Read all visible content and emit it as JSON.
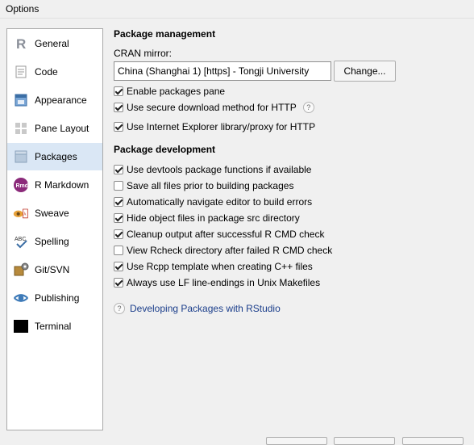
{
  "window": {
    "title": "Options"
  },
  "sidebar": {
    "items": [
      {
        "label": "General",
        "icon": "r-logo-icon",
        "active": false
      },
      {
        "label": "Code",
        "icon": "code-document-icon",
        "active": false
      },
      {
        "label": "Appearance",
        "icon": "appearance-icon",
        "active": false
      },
      {
        "label": "Pane Layout",
        "icon": "pane-layout-icon",
        "active": false
      },
      {
        "label": "Packages",
        "icon": "packages-icon",
        "active": true
      },
      {
        "label": "R Markdown",
        "icon": "rmd-icon",
        "active": false
      },
      {
        "label": "Sweave",
        "icon": "sweave-icon",
        "active": false
      },
      {
        "label": "Spelling",
        "icon": "spelling-icon",
        "active": false
      },
      {
        "label": "Git/SVN",
        "icon": "git-icon",
        "active": false
      },
      {
        "label": "Publishing",
        "icon": "publishing-icon",
        "active": false
      },
      {
        "label": "Terminal",
        "icon": "terminal-icon",
        "active": false
      }
    ]
  },
  "management": {
    "title": "Package management",
    "cran_label": "CRAN mirror:",
    "cran_value": "China (Shanghai 1) [https] - Tongji University",
    "change_button": "Change...",
    "options": [
      {
        "label": "Enable packages pane",
        "checked": true
      },
      {
        "label": "Use secure download method for HTTP",
        "checked": true,
        "help": "?"
      },
      {
        "label": "Use Internet Explorer library/proxy for HTTP",
        "checked": true
      }
    ]
  },
  "development": {
    "title": "Package development",
    "options": [
      {
        "label": "Use devtools package functions if available",
        "checked": true
      },
      {
        "label": "Save all files prior to building packages",
        "checked": false
      },
      {
        "label": "Automatically navigate editor to build errors",
        "checked": true
      },
      {
        "label": "Hide object files in package src directory",
        "checked": true
      },
      {
        "label": "Cleanup output after successful R CMD check",
        "checked": true
      },
      {
        "label": "View Rcheck directory after failed R CMD check",
        "checked": false
      },
      {
        "label": "Use Rcpp template when creating C++ files",
        "checked": true
      },
      {
        "label": "Always use LF line-endings in Unix Makefiles",
        "checked": true
      }
    ],
    "help_link": "Developing Packages with RStudio",
    "help_glyph": "?"
  },
  "colors": {
    "accent": "#dae7f5",
    "link": "#1b3e8b"
  }
}
